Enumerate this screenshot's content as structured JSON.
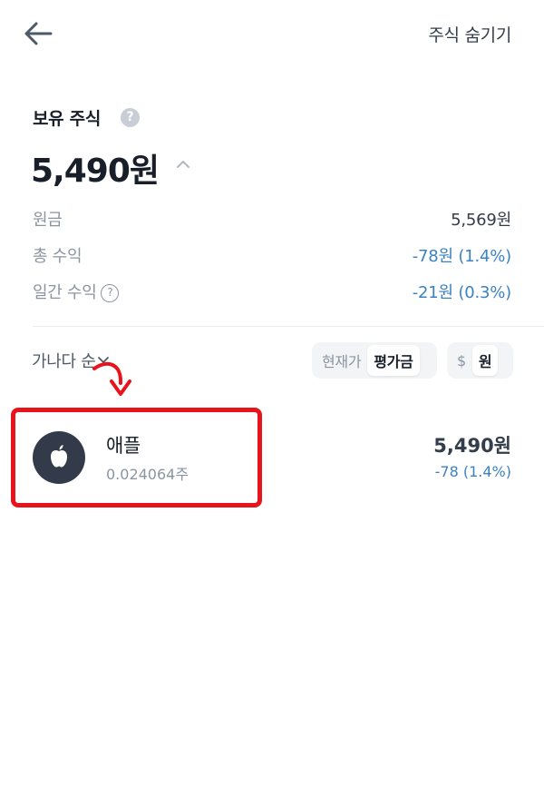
{
  "header": {
    "hide_stocks_label": "주식 숨기기"
  },
  "holdings": {
    "title": "보유 주식",
    "help": "?",
    "total_value": "5,490원"
  },
  "summary": {
    "principal": {
      "label": "원금",
      "value": "5,569원"
    },
    "total_return": {
      "label": "총 수익",
      "value": "-78원 (1.4%)"
    },
    "daily_return": {
      "label": "일간 수익",
      "value": "-21원 (0.3%)",
      "help": "?"
    }
  },
  "controls": {
    "sort_label": "가나다 순",
    "price_toggle": {
      "options": [
        "현재가",
        "평가금"
      ],
      "selected": "평가금"
    },
    "currency_toggle": {
      "options": [
        "$",
        "원"
      ],
      "selected": "원"
    }
  },
  "stocks": [
    {
      "name": "애플",
      "quantity": "0.024064주",
      "value": "5,490원",
      "change": "-78 (1.4%)",
      "logo": "apple-logo-icon"
    }
  ],
  "colors": {
    "loss": "#3b82c4",
    "highlight": "#e8141b",
    "logo_bg": "#333b4a"
  }
}
